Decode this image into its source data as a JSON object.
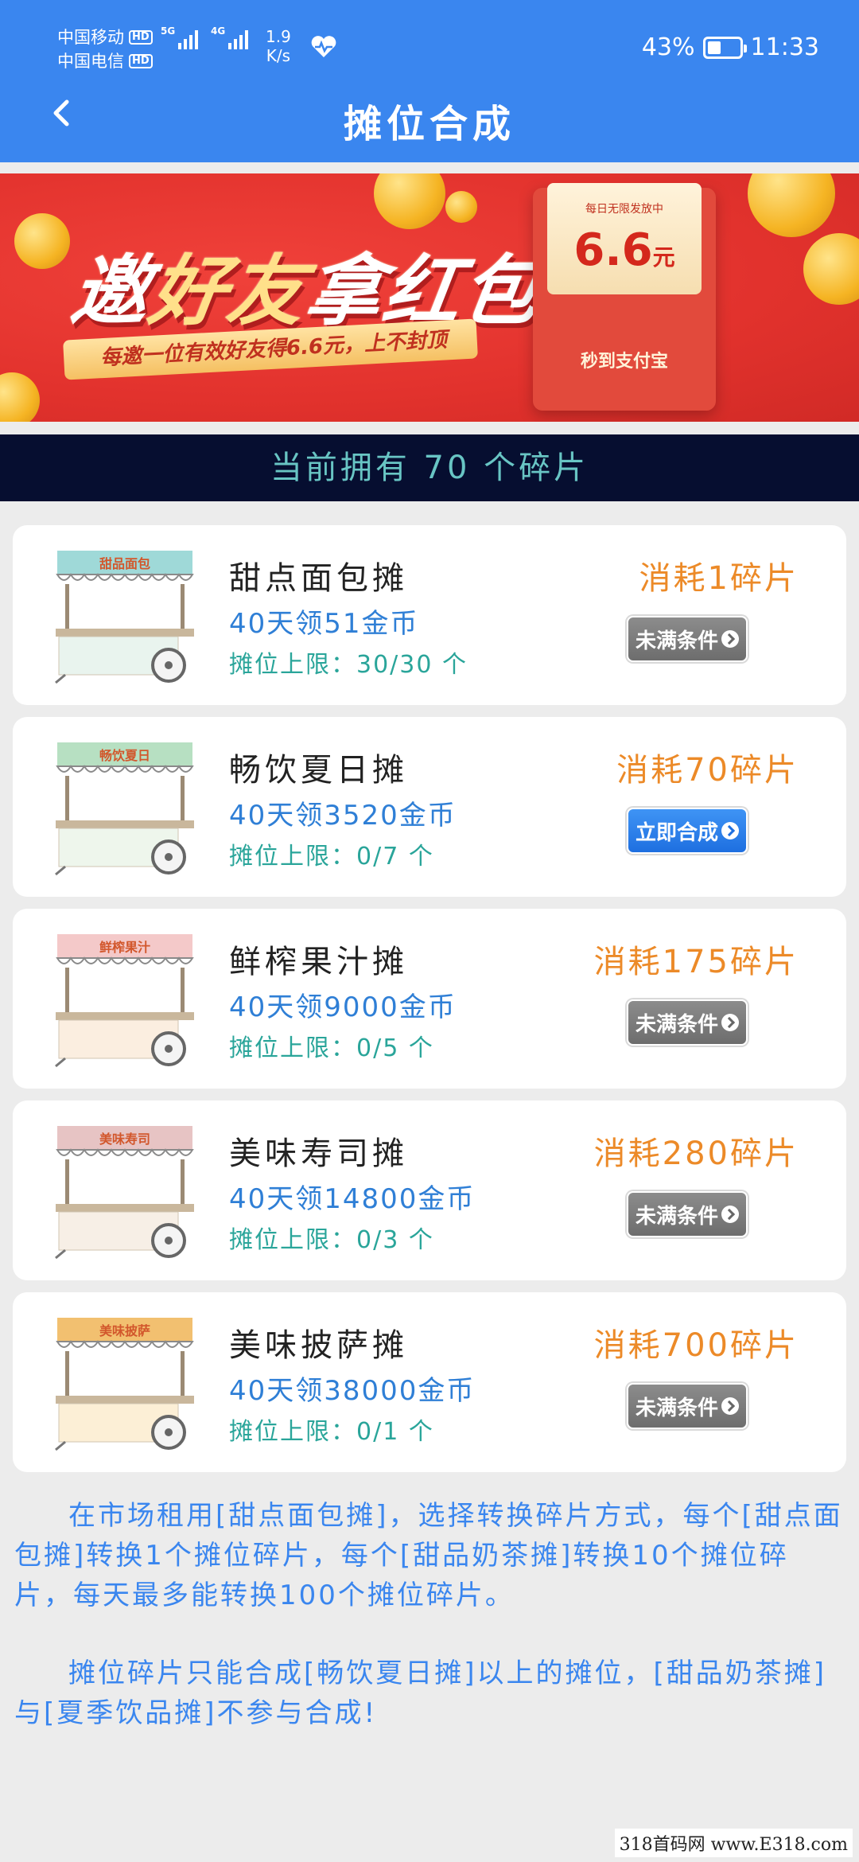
{
  "status_bar": {
    "carrier1": "中国移动",
    "carrier2": "中国电信",
    "hd_label": "HD",
    "net1": "5G",
    "net2": "4G",
    "speed_value": "1.9",
    "speed_unit": "K/s",
    "battery": "43%",
    "battery_level": 0.43,
    "time": "11:33"
  },
  "header": {
    "title": "摊位合成"
  },
  "banner": {
    "title_white": "邀",
    "title_gold": "好友",
    "title_white2": "拿红包",
    "ribbon": "每邀一位有效好友得6.6元，上不封顶",
    "envelope_top": "每日无限发放中",
    "envelope_amount": "6.6",
    "envelope_unit": "元",
    "envelope_bottom": "秒到支付宝"
  },
  "fragments": {
    "text": "当前拥有 70 个碎片"
  },
  "stalls": [
    {
      "name": "甜点面包摊",
      "reward": "40天领51金币",
      "limit": "摊位上限：30/30 个",
      "cost": "消耗1碎片",
      "button": "未满条件",
      "status": "disabled",
      "sign": "甜品面包",
      "awning": "#9fd9d8",
      "body": "#e9f4ee"
    },
    {
      "name": "畅饮夏日摊",
      "reward": "40天领3520金币",
      "limit": "摊位上限：0/7 个",
      "cost": "消耗70碎片",
      "button": "立即合成",
      "status": "active",
      "sign": "畅饮夏日",
      "awning": "#b7e0c2",
      "body": "#eef6ec"
    },
    {
      "name": "鲜榨果汁摊",
      "reward": "40天领9000金币",
      "limit": "摊位上限：0/5 个",
      "cost": "消耗175碎片",
      "button": "未满条件",
      "status": "disabled",
      "sign": "鲜榨果汁",
      "awning": "#f4c9c9",
      "body": "#fbeee0"
    },
    {
      "name": "美味寿司摊",
      "reward": "40天领14800金币",
      "limit": "摊位上限：0/3 个",
      "cost": "消耗280碎片",
      "button": "未满条件",
      "status": "disabled",
      "sign": "美味寿司",
      "awning": "#e7c4c4",
      "body": "#f7efe6"
    },
    {
      "name": "美味披萨摊",
      "reward": "40天领38000金币",
      "limit": "摊位上限：0/1 个",
      "cost": "消耗700碎片",
      "button": "未满条件",
      "status": "disabled",
      "sign": "美味披萨",
      "awning": "#f2c070",
      "body": "#fcefd6"
    }
  ],
  "notes": {
    "p1": "在市场租用[甜点面包摊]，选择转换碎片方式，每个[甜点面包摊]转换1个摊位碎片，每个[甜品奶茶摊]转换10个摊位碎片，每天最多能转换100个摊位碎片。",
    "p2": "摊位碎片只能合成[畅饮夏日摊]以上的摊位，[甜品奶茶摊]与[夏季饮品摊]不参与合成!"
  },
  "watermark": "318首码网 www.E318.com"
}
